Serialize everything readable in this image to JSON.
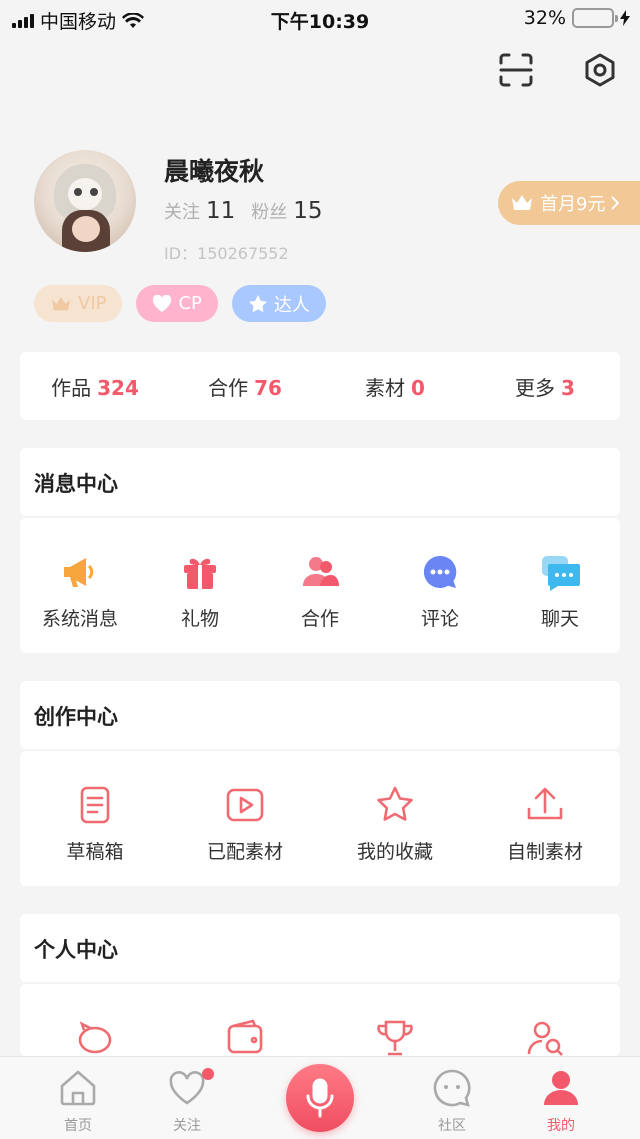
{
  "status_bar": {
    "carrier": "中国移动",
    "time": "下午10:39",
    "battery": "32%"
  },
  "profile": {
    "name": "晨曦夜秋",
    "follow_label": "关注",
    "follow_count": "11",
    "fans_label": "粉丝",
    "fans_count": "15",
    "id_text": "ID：150267552",
    "promo": "首月9元"
  },
  "tags": [
    {
      "label": "VIP"
    },
    {
      "label": "CP"
    },
    {
      "label": "达人"
    }
  ],
  "stats": [
    {
      "label": "作品",
      "value": "324"
    },
    {
      "label": "合作",
      "value": "76"
    },
    {
      "label": "素材",
      "value": "0"
    },
    {
      "label": "更多",
      "value": "3"
    }
  ],
  "message_center": {
    "title": "消息中心",
    "items": [
      {
        "label": "系统消息",
        "icon": "megaphone-icon"
      },
      {
        "label": "礼物",
        "icon": "gift-icon"
      },
      {
        "label": "合作",
        "icon": "users-icon"
      },
      {
        "label": "评论",
        "icon": "comment-icon"
      },
      {
        "label": "聊天",
        "icon": "chat-icon"
      }
    ]
  },
  "creation_center": {
    "title": "创作中心",
    "items": [
      {
        "label": "草稿箱",
        "icon": "document-icon"
      },
      {
        "label": "已配素材",
        "icon": "video-icon"
      },
      {
        "label": "我的收藏",
        "icon": "star-icon"
      },
      {
        "label": "自制素材",
        "icon": "upload-icon"
      }
    ]
  },
  "personal_center": {
    "title": "个人中心"
  },
  "tabbar": [
    {
      "label": "首页",
      "icon": "home-icon"
    },
    {
      "label": "关注",
      "icon": "heart-icon"
    },
    {
      "label": "社区",
      "icon": "community-icon"
    },
    {
      "label": "我的",
      "icon": "profile-icon"
    }
  ],
  "colors": {
    "accent": "#f2596a",
    "vip_gold": "#f1c896",
    "background": "#f4f4f4"
  }
}
